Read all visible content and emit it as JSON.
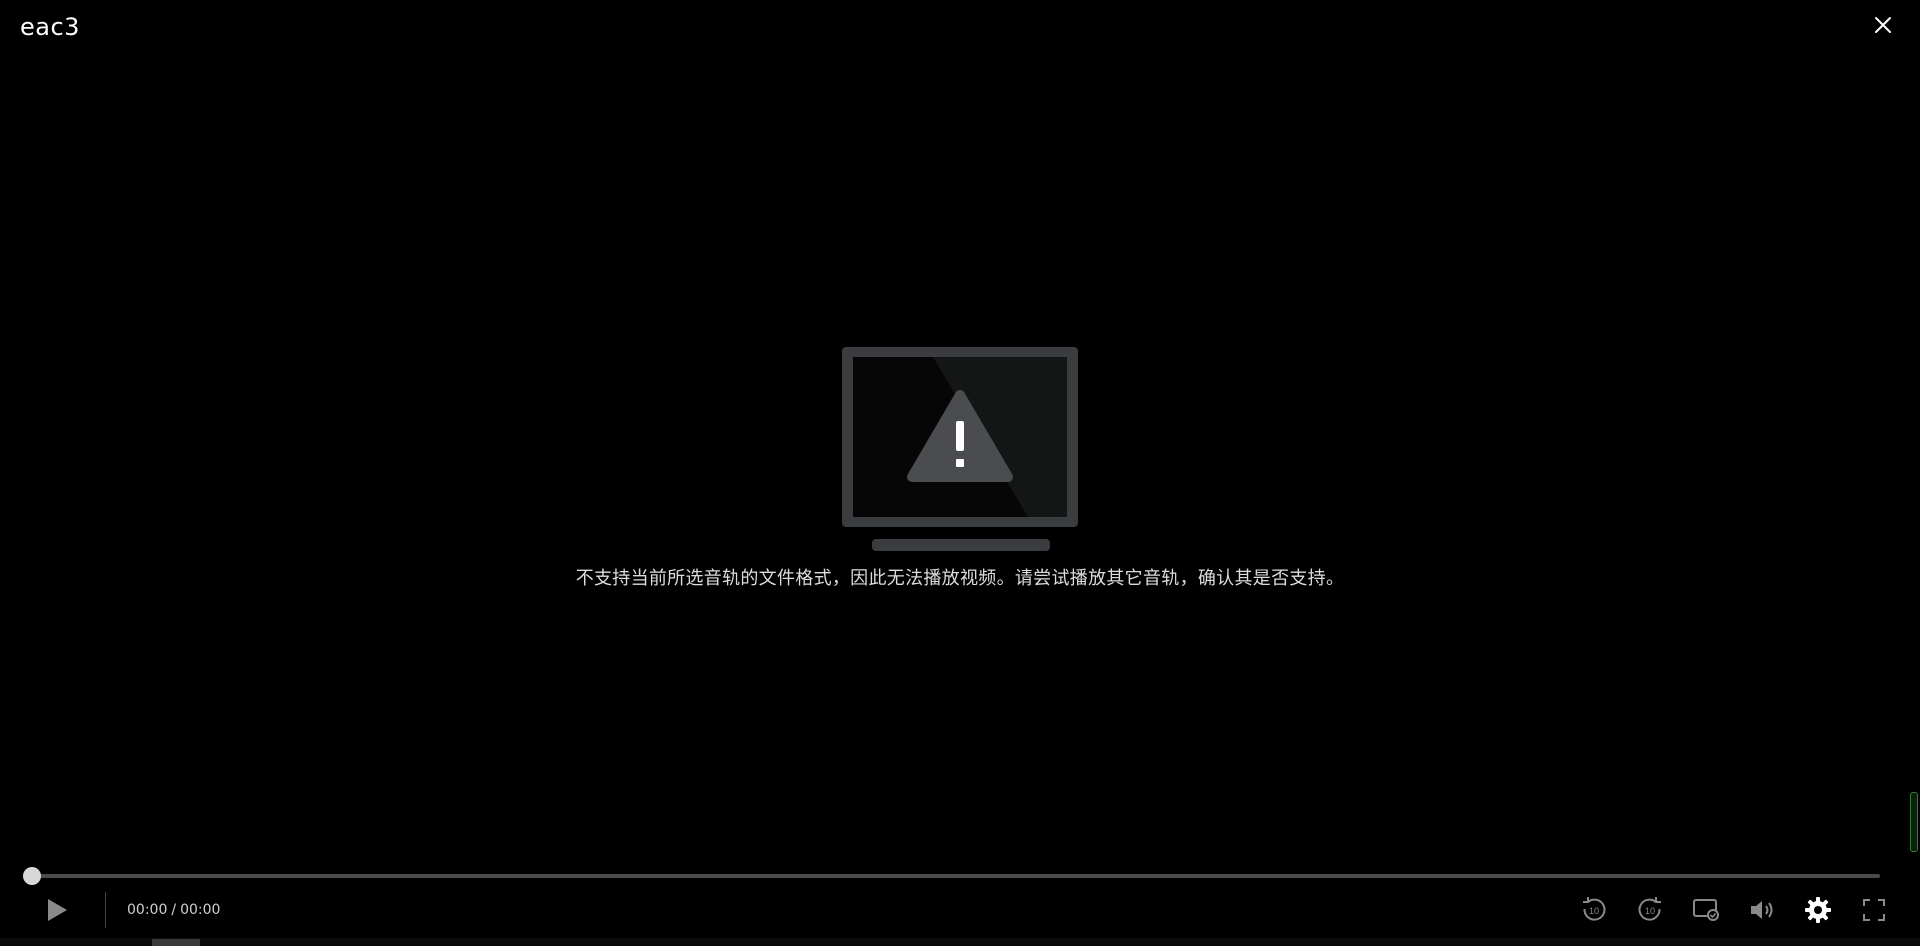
{
  "window": {
    "title": "eac3",
    "close_icon": "close-icon"
  },
  "error": {
    "icon": "monitor-warning-icon",
    "message": "不支持当前所选音轨的文件格式，因此无法播放视频。请尝试播放其它音轨，确认其是否支持。"
  },
  "playback": {
    "progress": 0,
    "current_time": "00:00",
    "separator": "/",
    "duration": "00:00"
  },
  "controls": {
    "play_icon": "play-icon",
    "rewind_label": "10",
    "forward_label": "10",
    "right_icons": [
      "rewind-10-icon",
      "forward-10-icon",
      "cast-icon",
      "volume-icon",
      "settings-icon",
      "fullscreen-icon"
    ]
  },
  "colors": {
    "background": "#000000",
    "icon": "#8a8a8a",
    "icon_active": "#ffffff",
    "track": "#4a4a4a",
    "knob": "#d8d8d8"
  }
}
